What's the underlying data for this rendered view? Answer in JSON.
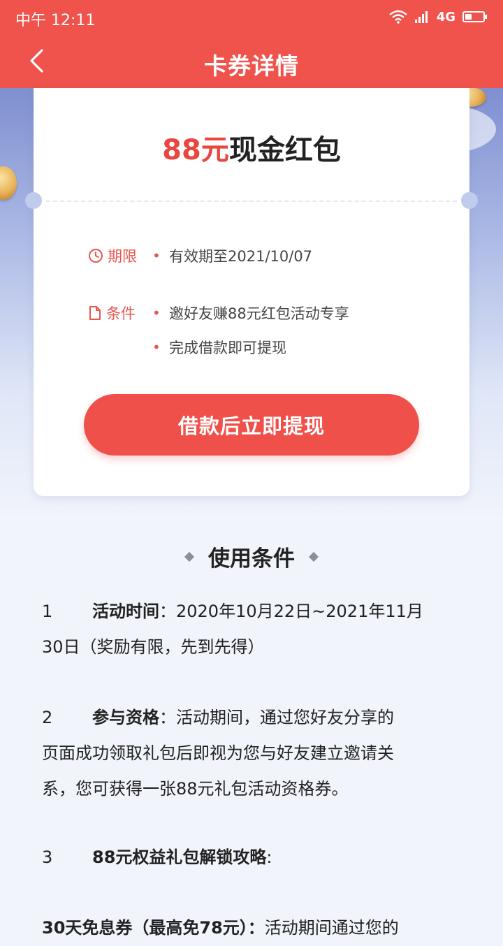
{
  "status_bar": {
    "time": "中午 12:11",
    "network": "4G"
  },
  "nav": {
    "title": "卡券详情",
    "back_icon": "chevron-left-icon"
  },
  "coupon": {
    "amount": "88元",
    "name": "现金红包",
    "validity": {
      "label": "期限",
      "icon": "clock-icon",
      "value": "有效期至2021/10/07"
    },
    "conditions": {
      "label": "条件",
      "icon": "document-icon",
      "items": [
        "邀好友赚88元红包活动专享",
        "完成借款即可提现"
      ]
    },
    "cta_label": "借款后立即提现"
  },
  "usage": {
    "heading": "使用条件",
    "terms": [
      {
        "no": "1",
        "head": "活动时间",
        "line1": "：2020年10月22日~2021年11月",
        "line2": "30日（奖励有限，先到先得）"
      },
      {
        "no": "2",
        "head": "参与资格",
        "line1": "：活动期间，通过您好友分享的",
        "line2": "页面成功领取礼包后即视为您与好友建立邀请关",
        "line3": "系，您可获得一张88元礼包活动资格券。"
      },
      {
        "no": "3",
        "head": "88元权益礼包解锁攻略",
        "tail": ":"
      }
    ],
    "bonus": {
      "head": "30天免息券（最高免78元）：",
      "text": "活动期间通过您的"
    }
  },
  "colors": {
    "brand_red": "#f0524c",
    "accent_red": "#e8463e",
    "page_bg": "#f1f4fb"
  }
}
